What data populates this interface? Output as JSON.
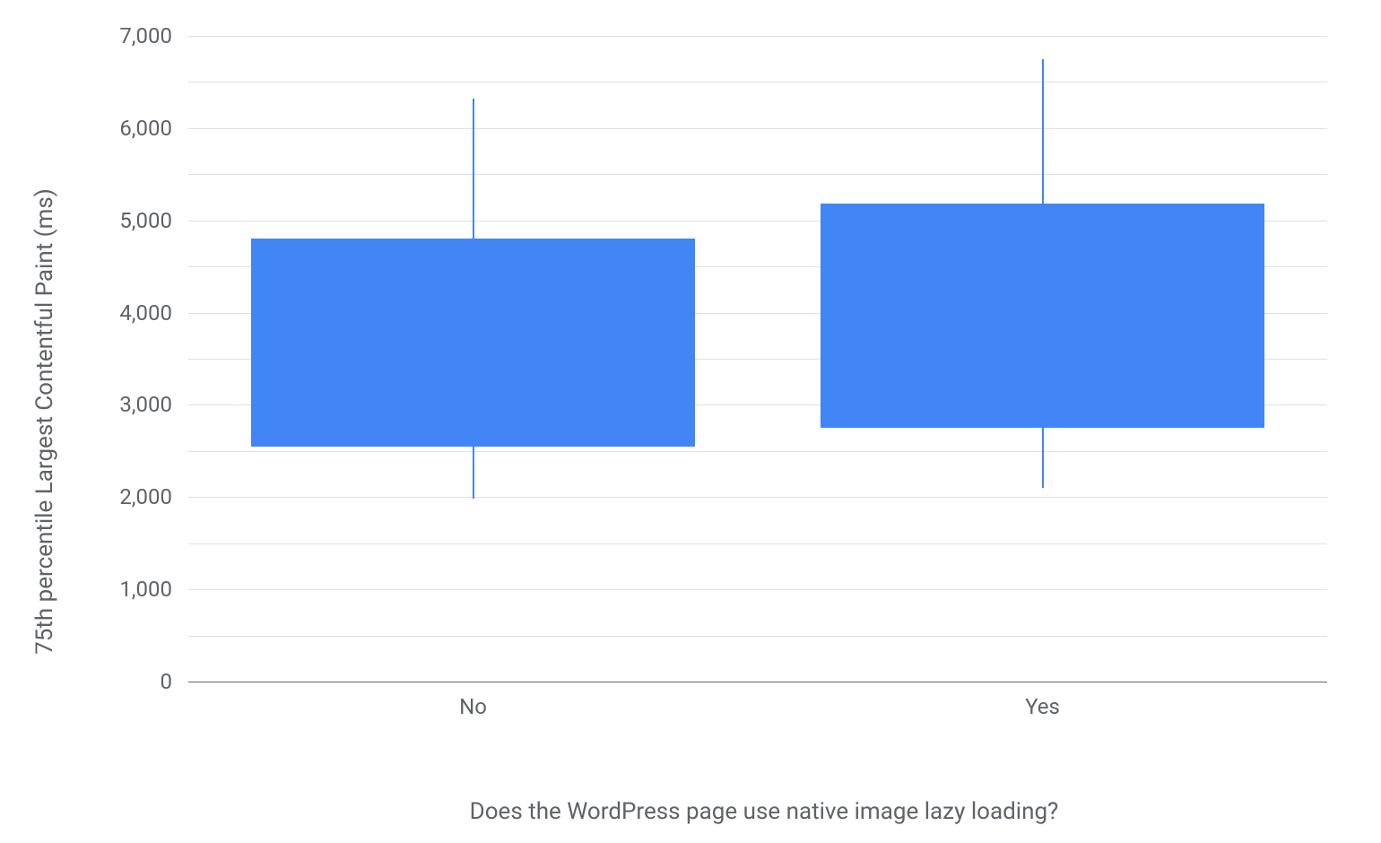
{
  "chart_data": {
    "type": "boxplot",
    "ylabel": "75th percentile Largest Contentful Paint (ms)",
    "xlabel": "Does the WordPress page use native image lazy loading?",
    "ylim": [
      0,
      7000
    ],
    "y_ticks": [
      0,
      1000,
      2000,
      3000,
      4000,
      5000,
      6000,
      7000
    ],
    "y_tick_labels": [
      "0",
      "1,000",
      "2,000",
      "3,000",
      "4,000",
      "5,000",
      "6,000",
      "7,000"
    ],
    "categories": [
      "No",
      "Yes"
    ],
    "series": [
      {
        "name": "No",
        "whisker_low": 1980,
        "q1": 2550,
        "q3": 4800,
        "whisker_high": 6320
      },
      {
        "name": "Yes",
        "whisker_low": 2100,
        "q1": 2750,
        "q3": 5180,
        "whisker_high": 6750
      }
    ],
    "colors": {
      "box_fill": "#4285f4",
      "grid": "#e0e0e0",
      "axis": "#5f6368",
      "text": "#5f6368"
    }
  }
}
